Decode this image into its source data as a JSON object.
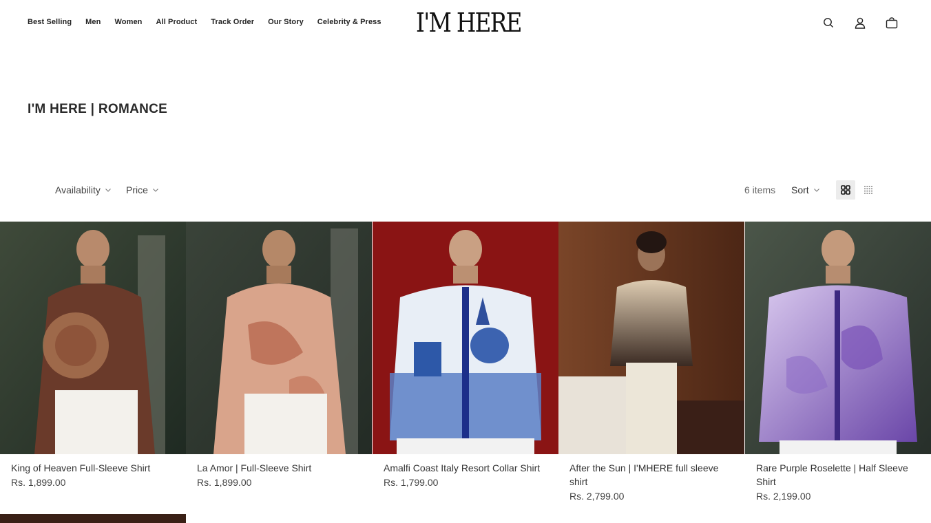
{
  "header": {
    "nav": [
      "Best Selling",
      "Men",
      "Women",
      "All Product",
      "Track Order",
      "Our Story",
      "Celebrity & Press"
    ],
    "logo": "I'M HERE",
    "icons": [
      "search-icon",
      "account-icon",
      "cart-icon"
    ]
  },
  "collection": {
    "title": "I'M HERE | ROMANCE"
  },
  "toolbar": {
    "filters": [
      "Availability",
      "Price"
    ],
    "count": "6 items",
    "sort_label": "Sort",
    "views": [
      "grid-large-icon",
      "grid-small-icon"
    ]
  },
  "products": [
    {
      "name": "King of Heaven Full-Sleeve Shirt",
      "price": "Rs. 1,899.00"
    },
    {
      "name": "La Amor | Full-Sleeve Shirt",
      "price": "Rs. 1,899.00"
    },
    {
      "name": "Amalfi Coast Italy Resort Collar Shirt",
      "price": "Rs. 1,799.00"
    },
    {
      "name": "After the Sun | I'MHERE full sleeve shirt",
      "price": "Rs. 2,799.00"
    },
    {
      "name": "Rare Purple Roselette | Half Sleeve Shirt",
      "price": "Rs. 2,199.00"
    }
  ],
  "colors": {
    "text": "#1a1a1a",
    "muted": "#666666",
    "active_view_bg": "#ececec"
  }
}
